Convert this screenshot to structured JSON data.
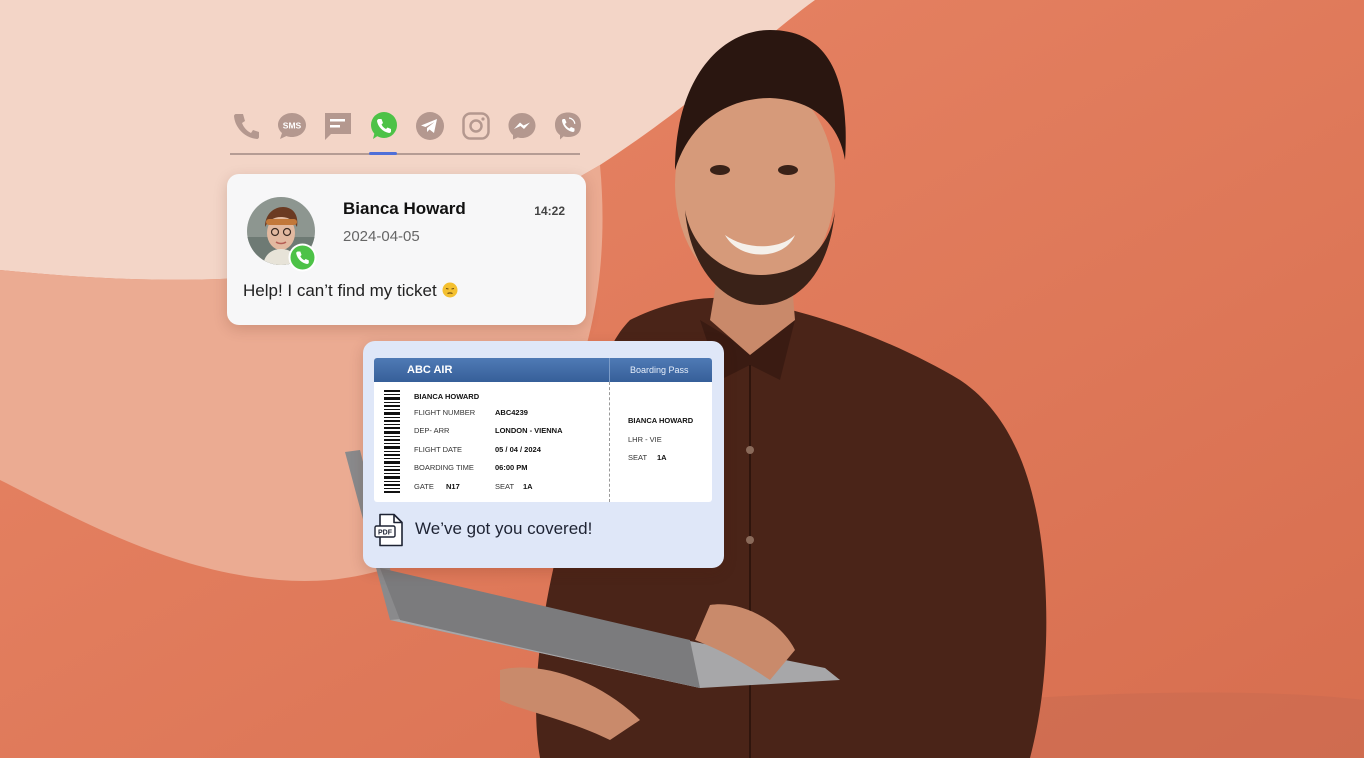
{
  "colors": {
    "background_orange": "#e2795a",
    "background_light": "#f3d3c5",
    "whatsapp_green": "#4dc247",
    "active_tab": "#4f6fd8",
    "ticket_header": "#3d67a3"
  },
  "channels": [
    {
      "icon": "phone-icon",
      "label": ""
    },
    {
      "icon": "sms-icon",
      "label": "SMS"
    },
    {
      "icon": "chat-icon",
      "label": ""
    },
    {
      "icon": "whatsapp-icon",
      "label": "",
      "active": true
    },
    {
      "icon": "telegram-icon",
      "label": ""
    },
    {
      "icon": "instagram-icon",
      "label": ""
    },
    {
      "icon": "messenger-icon",
      "label": ""
    },
    {
      "icon": "viber-icon",
      "label": ""
    }
  ],
  "message": {
    "sender": "Bianca Howard",
    "time": "14:22",
    "date": "2024-04-05",
    "text": "Help! I can’t find my ticket",
    "emoji": "pensive-face-icon"
  },
  "ticket": {
    "airline": "ABC AIR",
    "pass_label": "Boarding Pass",
    "passenger": "BIANCA HOWARD",
    "flight_number_label": "FLIGHT NUMBER",
    "flight_number": "ABC4239",
    "dep_arr_label": "DEP- ARR",
    "dep_arr": "LONDON - VIENNA",
    "flight_date_label": "FLIGHT DATE",
    "flight_date": "05 / 04 / 2024",
    "boarding_time_label": "BOARDING TIME",
    "boarding_time": "06:00 PM",
    "gate_label": "GATE",
    "gate": "N17",
    "seat_label": "SEAT",
    "seat": "1A",
    "stub_passenger": "BIANCA HOWARD",
    "stub_route": "LHR - VIE",
    "stub_seat_label": "SEAT",
    "stub_seat": "1A"
  },
  "reply": {
    "file_type": "PDF",
    "text": "We’ve got you covered!"
  }
}
